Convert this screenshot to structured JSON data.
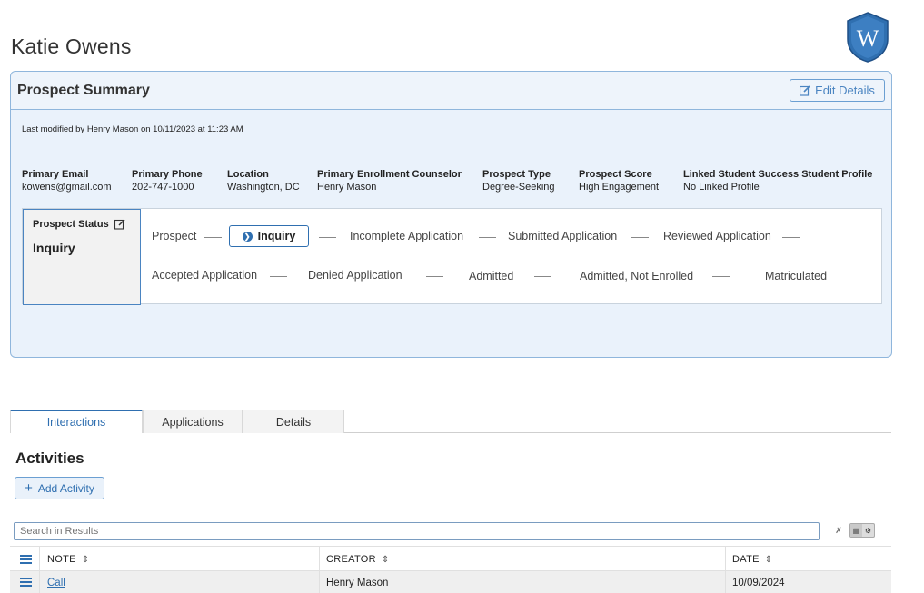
{
  "page": {
    "title": "Katie Owens"
  },
  "summary": {
    "title": "Prospect Summary",
    "edit_label": "Edit Details",
    "last_modified": "Last modified by Henry Mason on 10/11/2023 at 11:23 AM",
    "fields": [
      {
        "label": "Primary Email",
        "value": "kowens@gmail.com"
      },
      {
        "label": "Primary Phone",
        "value": "202-747-1000"
      },
      {
        "label": "Location",
        "value": "Washington, DC"
      },
      {
        "label": "Primary Enrollment Counselor",
        "value": "Henry Mason"
      },
      {
        "label": "Prospect Type",
        "value": "Degree-Seeking"
      },
      {
        "label": "Prospect Score",
        "value": "High Engagement"
      },
      {
        "label": "Linked Student Success Student Profile",
        "value": "No Linked Profile"
      }
    ],
    "status": {
      "label": "Prospect Status",
      "value": "Inquiry",
      "stages": [
        "Prospect",
        "Inquiry",
        "Incomplete Application",
        "Submitted Application",
        "Reviewed Application",
        "Accepted Application",
        "Denied Application",
        "Admitted",
        "Admitted, Not Enrolled",
        "Matriculated"
      ],
      "current_stage": "Inquiry"
    }
  },
  "tabs": [
    {
      "label": "Interactions",
      "active": true
    },
    {
      "label": "Applications",
      "active": false
    },
    {
      "label": "Details",
      "active": false
    }
  ],
  "activities": {
    "title": "Activities",
    "add_label": "Add Activity",
    "search_placeholder": "Search in Results",
    "columns": [
      "Note",
      "Creator",
      "Date"
    ],
    "rows": [
      {
        "note": "Call",
        "creator": "Henry Mason",
        "date": "10/09/2024"
      }
    ]
  },
  "logo": {
    "letter": "W",
    "color": "#2f6fb0"
  },
  "colors": {
    "accent": "#2f6fb0",
    "panel_bg": "#eaf2fb",
    "panel_border": "#8fb6dc"
  }
}
